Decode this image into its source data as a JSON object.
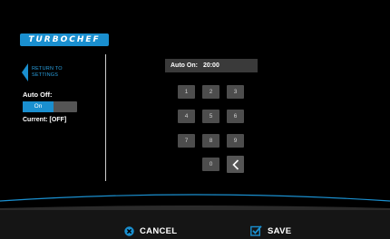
{
  "brand": {
    "logo_text": "TURBOCHEF"
  },
  "sidebar": {
    "return_label": "RETURN TO SETTINGS",
    "auto_off_label": "Auto Off:",
    "toggle_on_label": "On",
    "current_label": "Current: [OFF]"
  },
  "display": {
    "label": "Auto On:",
    "value": "20:00"
  },
  "keypad": {
    "keys": [
      "1",
      "2",
      "3",
      "4",
      "5",
      "6",
      "7",
      "8",
      "9",
      "0"
    ],
    "backspace_icon": "chevron-left-icon"
  },
  "footer": {
    "cancel_label": "CANCEL",
    "save_label": "SAVE"
  },
  "colors": {
    "accent": "#1a8fcf",
    "background": "#000000",
    "key": "#4d4d4d",
    "bottom_bar": "#151515"
  }
}
